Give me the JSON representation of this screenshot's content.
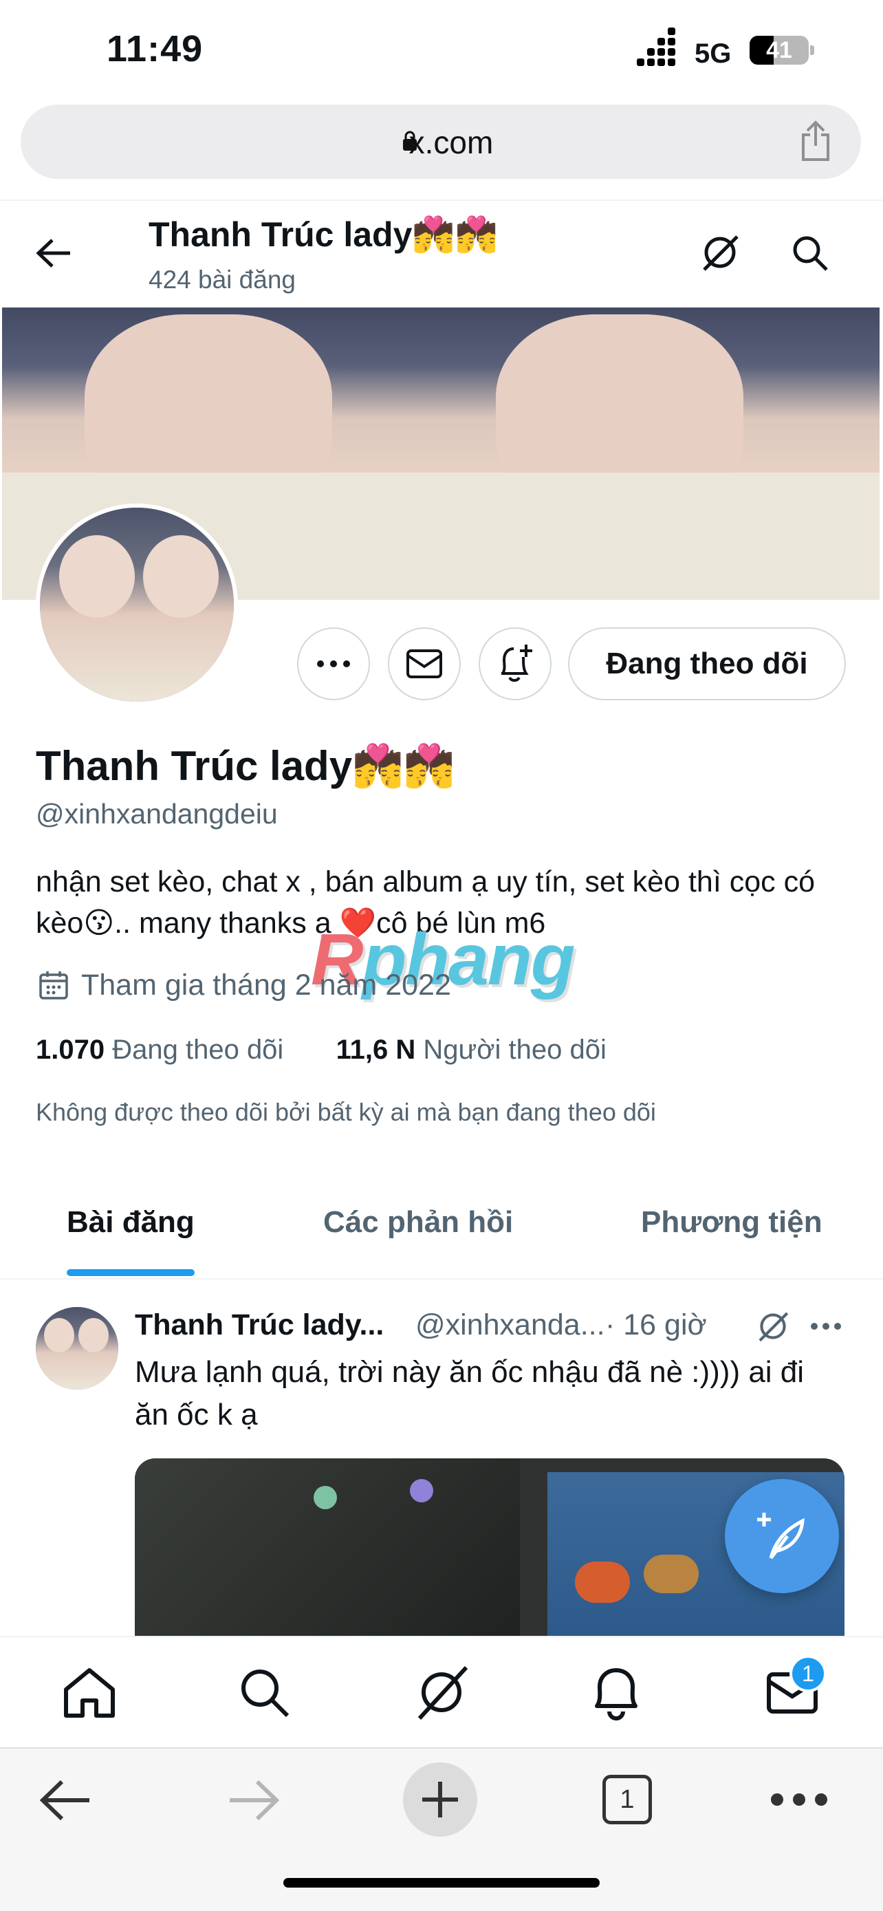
{
  "status_bar": {
    "time": "11:49",
    "network": "5G",
    "battery": "41",
    "battery_level": 0.41
  },
  "browser": {
    "url": "x.com",
    "tab_count": "1"
  },
  "header": {
    "name": "Thanh Trúc lady💏💏",
    "post_count": "424 bài đăng"
  },
  "profile": {
    "display_name": "Thanh Trúc lady💏💏",
    "handle": "@xinhxandangdeiu",
    "bio": "nhận set kèo, chat x , bán album ạ uy tín, set kèo thì cọc có kèo😗.. many thanks ạ ❤️cô bé lùn m6",
    "joined": "Tham gia tháng 2 năm 2022",
    "following_count": "1.070",
    "following_label": "Đang theo dõi",
    "followers_count": "11,6 N",
    "followers_label": "Người theo dõi",
    "not_followed_note": "Không được theo dõi bởi bất kỳ ai mà bạn đang theo dõi",
    "follow_button": "Đang theo dõi"
  },
  "tabs": [
    {
      "label": "Bài đăng",
      "active": true
    },
    {
      "label": "Các phản hồi",
      "active": false
    },
    {
      "label": "Phương tiện",
      "active": false
    }
  ],
  "post": {
    "name": "Thanh Trúc lady...",
    "handle": "@xinhxanda...",
    "time": "· 16 giờ",
    "text": "Mưa lạnh quá, trời này ăn ốc nhậu đã nè :)))) ai đi ăn ốc k ạ"
  },
  "bottom_nav": {
    "messages_badge": "1"
  },
  "watermark": {
    "first": "R",
    "rest": "phang"
  },
  "colors": {
    "accent": "#1d9bf0",
    "fab": "#4a99e9",
    "secondary_text": "#536471"
  }
}
